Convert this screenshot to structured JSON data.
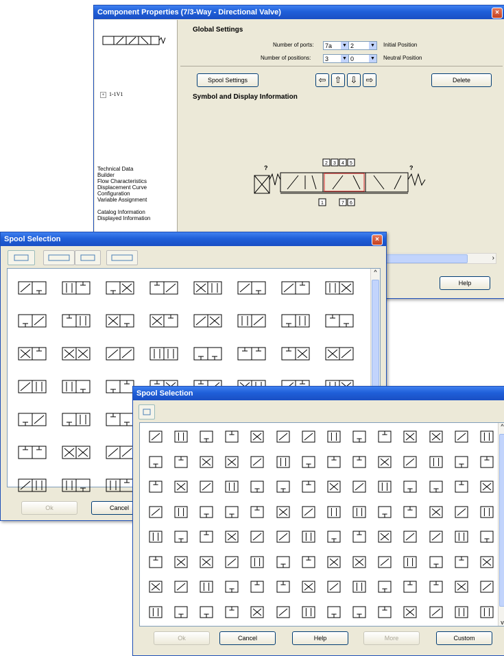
{
  "props": {
    "title": "Component Properties (7/3-Way - Directional Valve)",
    "tree_item": "1-1V1",
    "sidebar_items": [
      "Technical Data",
      "Builder",
      "Flow Characteristics",
      "Displacement Curve",
      "Configuration",
      "Variable Assignment",
      "",
      "Catalog Information",
      "Displayed Information"
    ],
    "global_settings": "Global Settings",
    "ports_label": "Number of ports:",
    "ports_value": "7a",
    "positions_label": "Number of positions:",
    "positions_value": "3",
    "initial_value": "2",
    "initial_label": "Initial Position",
    "neutral_value": "0",
    "neutral_label": "Neutral Position",
    "spool_settings": "Spool Settings",
    "delete": "Delete",
    "symbol_section": "Symbol and Display Information",
    "help": "Help",
    "port_labels_top": [
      "2",
      "3",
      "4",
      "5"
    ],
    "port_labels_bottom": [
      "1",
      "7",
      "6"
    ],
    "question": "?"
  },
  "spool1": {
    "title": "Spool Selection",
    "ok": "Ok",
    "cancel": "Cancel"
  },
  "spool2": {
    "title": "Spool Selection",
    "ok": "Ok",
    "cancel": "Cancel",
    "help": "Help",
    "more": "More",
    "custom": "Custom"
  },
  "icons": {
    "close": "×",
    "arrow_left": "⇦",
    "arrow_up": "⇧",
    "arrow_down": "⇩",
    "arrow_right": "⇨",
    "dropdown": "▼",
    "scroll_up": "^",
    "scroll_down": "v",
    "scroll_right": "›",
    "expand": "+"
  }
}
